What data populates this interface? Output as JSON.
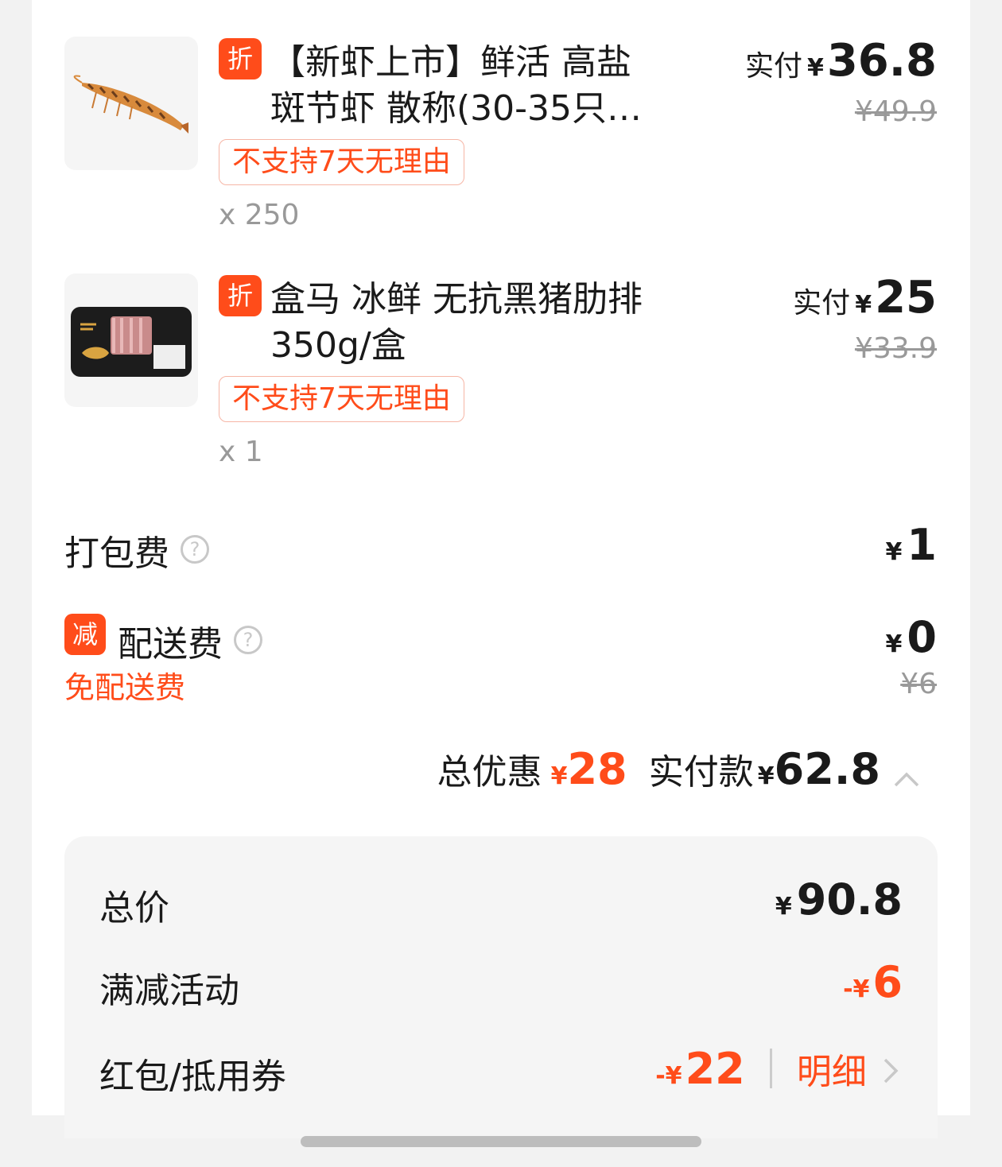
{
  "products": [
    {
      "tag": "折",
      "title_line1": "【新虾上市】鲜活 高盐",
      "title_line2": "斑节虾 散称(30-35只…",
      "badge": "不支持7天无理由",
      "quantity": "x 250",
      "paid_label": "实付",
      "currency": "¥",
      "paid_amount": "36.8",
      "original_price": "¥49.9"
    },
    {
      "tag": "折",
      "title_line1": "盒马 冰鲜 无抗黑猪肋排",
      "title_line2": "350g/盒",
      "badge": "不支持7天无理由",
      "quantity": "x 1",
      "paid_label": "实付",
      "currency": "¥",
      "paid_amount": "25",
      "original_price": "¥33.9"
    }
  ],
  "packing_fee": {
    "label": "打包费",
    "help": "?",
    "currency": "¥",
    "amount": "1"
  },
  "delivery_fee": {
    "tag": "减",
    "label": "配送费",
    "help": "?",
    "note": "免配送费",
    "currency": "¥",
    "amount": "0",
    "original": "¥6"
  },
  "summary": {
    "discount_label": "总优惠",
    "discount_currency": "¥",
    "discount_amount": "28",
    "paid_label": "实付款",
    "paid_currency": "¥",
    "paid_amount": "62.8"
  },
  "breakdown": {
    "total_label": "总价",
    "total_currency": "¥",
    "total_amount": "90.8",
    "promo_label": "满减活动",
    "promo_prefix": "-¥",
    "promo_amount": "6",
    "coupon_label": "红包/抵用券",
    "coupon_prefix": "-¥",
    "coupon_amount": "22",
    "detail_label": "明细"
  },
  "colors": {
    "accent": "#ff4c1a",
    "muted": "#999999",
    "panel": "#f5f5f5"
  }
}
